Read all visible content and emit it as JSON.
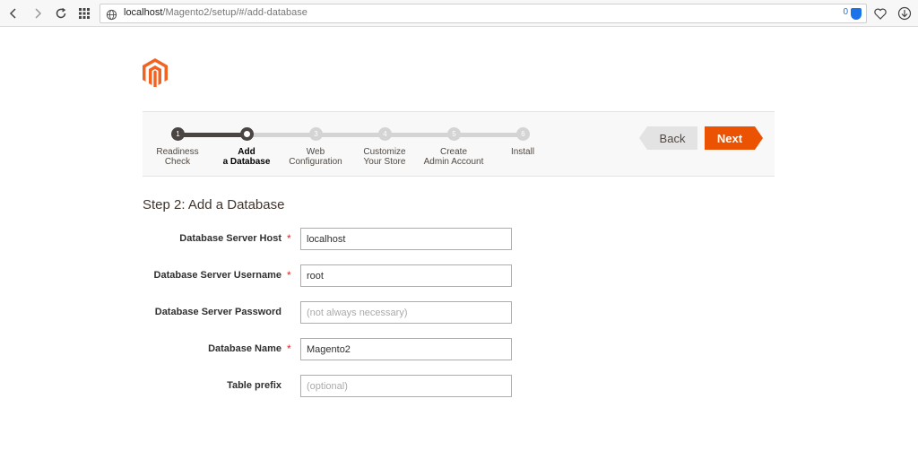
{
  "browser": {
    "url_host": "localhost",
    "url_path": "/Magento2/setup/#/add-database",
    "badge_count": "0"
  },
  "steps": [
    {
      "number": "1",
      "label": "Readiness\nCheck",
      "state": "done"
    },
    {
      "number": "2",
      "label": "Add\na Database",
      "state": "active"
    },
    {
      "number": "3",
      "label": "Web\nConfiguration",
      "state": "todo"
    },
    {
      "number": "4",
      "label": "Customize\nYour Store",
      "state": "todo"
    },
    {
      "number": "5",
      "label": "Create\nAdmin Account",
      "state": "todo"
    },
    {
      "number": "6",
      "label": "Install",
      "state": "todo"
    }
  ],
  "buttons": {
    "back": "Back",
    "next": "Next"
  },
  "form": {
    "title": "Step 2: Add a Database",
    "required_mark": "*",
    "host": {
      "label": "Database Server Host",
      "value": "localhost",
      "placeholder": "",
      "required": true
    },
    "username": {
      "label": "Database Server Username",
      "value": "root",
      "placeholder": "",
      "required": true
    },
    "password": {
      "label": "Database Server Password",
      "value": "",
      "placeholder": "(not always necessary)",
      "required": false
    },
    "dbname": {
      "label": "Database Name",
      "value": "Magento2",
      "placeholder": "",
      "required": true
    },
    "prefix": {
      "label": "Table prefix",
      "value": "",
      "placeholder": "(optional)",
      "required": false
    }
  },
  "colors": {
    "accent": "#eb5202",
    "progress_done": "#4a4542",
    "progress_todo": "#d4d4d4"
  }
}
